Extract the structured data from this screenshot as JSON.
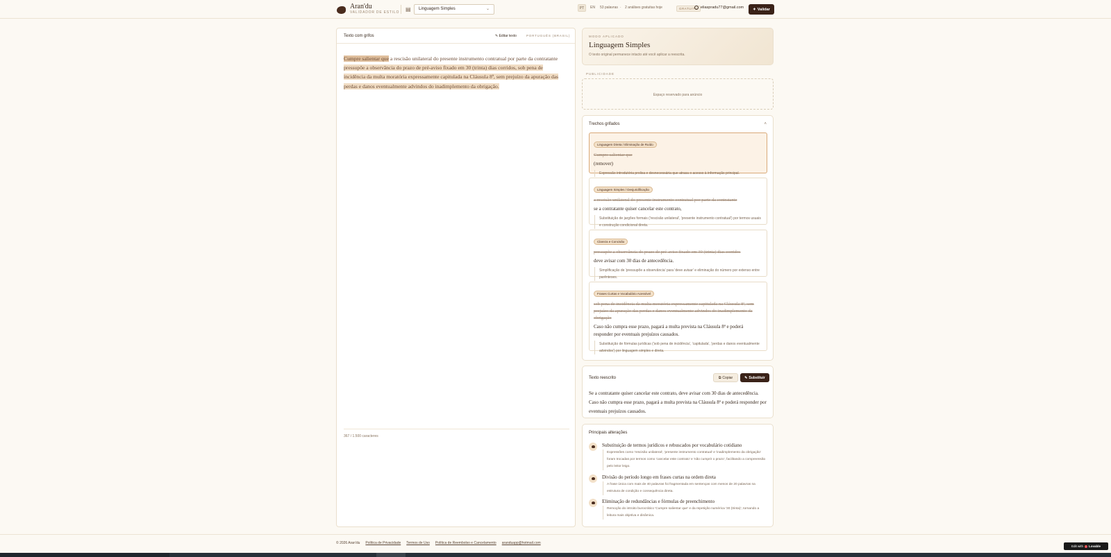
{
  "header": {
    "brand_name": "Aran'du",
    "brand_sub": "VALIDADOR DE ESTILO",
    "mode_selected": "Linguagem Simples",
    "lang_pt": "PT",
    "lang_en": "EN",
    "words": "53 palavras",
    "sep": "·",
    "free_analyses": "2 análises gratuitas hoje",
    "badge": "GRATUITO",
    "user_email": "eliaspradu77@gmail.com",
    "validate_label": "Validar"
  },
  "left": {
    "title": "Texto com grifos",
    "edit_label": "Editar texto",
    "language": "PORTUGUÊS (BRASIL)",
    "segments": [
      {
        "text": "Cumpre salientar que",
        "style": "hl-strong"
      },
      {
        "text": " a rescisão unilateral do presente instrumento contratual por parte da contratante",
        "style": ""
      },
      {
        "text": " pressupõe a observância do prazo de pré-aviso fixado em 30 (trinta) dias corridos,",
        "style": "hl"
      },
      {
        "text": " sob pena de incidência da multa moratória expressamente capitulada na Cláusula 8ª, sem prejuízo da apuração das perdas e danos eventualmente advindos do inadimplemento da obrigação.",
        "style": "hl"
      }
    ],
    "char_count": "367 / 1.500 caracteres"
  },
  "mode_card": {
    "label": "MODO APLICADO",
    "title": "Linguagem Simples",
    "desc": "O texto original permanece intacto até você aplicar a reescrita."
  },
  "ad": {
    "label": "PUBLICIDADE",
    "text": "Espaço reservado para anúncio"
  },
  "trechos": {
    "title": "Trechos grifados",
    "items": [
      {
        "tag": "Linguagem Direta / Eliminação de Ruído",
        "original": "Cumpre salientar que",
        "replacement": "(remover)",
        "reason": "Expressão introdutória prolixa e desnecessária que atrasa o acesso à informação principal."
      },
      {
        "tag": "Linguagem Simples / Desjuridificação",
        "original": "a rescisão unilateral do presente instrumento contratual por parte da contratante",
        "replacement": "se a contratante quiser cancelar este contrato,",
        "reason": "Substituição de jargões formais ('rescisão unilateral', 'presente instrumento contratual') por termos usuais e construção condicional direta."
      },
      {
        "tag": "Clareza e Concisão",
        "original": "pressupõe a observância do prazo de pré-aviso fixado em 30 (trinta) dias corridos",
        "replacement": "deve avisar com 30 dias de antecedência.",
        "reason": "Simplificação de 'pressupõe a observância' para 'deve avisar' e eliminação do número por extenso entre parênteses."
      },
      {
        "tag": "Frases Curtas e Vocabulário Acessível",
        "original": "sob pena de incidência da multa moratória expressamente capitulada na Cláusula 8ª, sem prejuízo da apuração das perdas e danos eventualmente advindos do inadimplemento da obrigação",
        "replacement": "Caso não cumpra esse prazo, pagará a multa prevista na Cláusula 8ª e poderá responder por eventuais prejuízos causados.",
        "reason": "Substituição de fórmulas jurídicas ('sob pena de incidência', 'capitulada', 'perdas e danos eventualmente advindos') por linguagem simples e direta."
      }
    ]
  },
  "rewrite": {
    "title": "Texto reescrito",
    "copy_label": "Copiar",
    "replace_label": "Substituir",
    "text": "Se a contratante quiser cancelar este contrato, deve avisar com 30 dias de antecedência. Caso não cumpra esse prazo, pagará a multa prevista na Cláusula 8ª e poderá responder por eventuais prejuízos causados."
  },
  "changes": {
    "title": "Principais alterações",
    "items": [
      {
        "head": "Substituição de termos jurídicos e rebuscados por vocabulário cotidiano",
        "body": "Expressões como 'rescisão unilateral', 'presente instrumento contratual' e 'inadimplemento da obrigação' foram trocadas por termos como 'cancelar este contrato' e 'não cumprir o prazo', facilitando a compreensão pelo leitor leigo."
      },
      {
        "head": "Divisão do período longo em frases curtas na ordem direta",
        "body": "A frase única com mais de 40 palavras foi fragmentada em sentenças com menos de 20 palavras na estrutura de condição e consequência direta."
      },
      {
        "head": "Eliminação de redundâncias e fórmulas de preenchimento",
        "body": "Remoção do introito burocrático 'Cumpre salientar que' e da repetição numérica '30 (trinta)', tornando a leitura mais objetiva e dinâmica."
      }
    ]
  },
  "footer": {
    "copyright": "© 2026 Aran'du",
    "privacy": "Política de Privacidade",
    "terms": "Termos de Uso",
    "refund": "Política de Reembolso e Cancelamento",
    "email": "aranduapp@hotmail.com"
  },
  "lovable": {
    "edit_with": "Edit with",
    "brand": "Lovable"
  }
}
